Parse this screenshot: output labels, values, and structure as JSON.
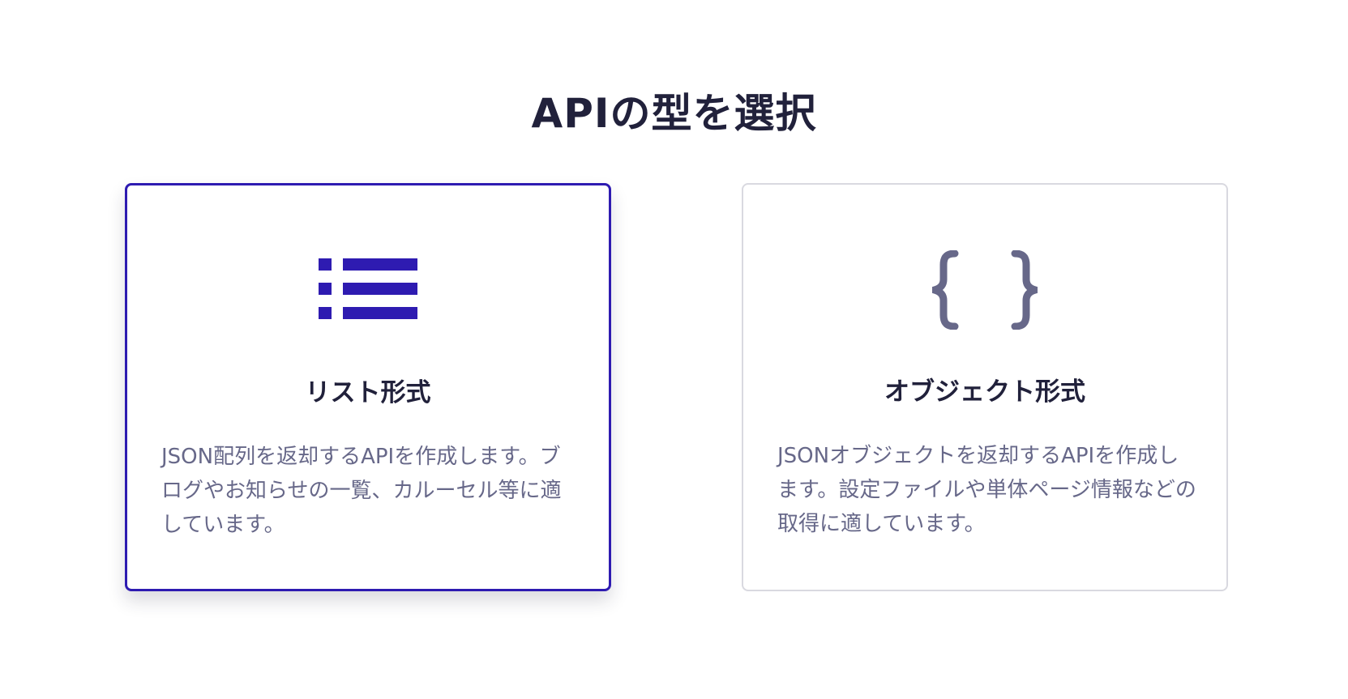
{
  "heading": "APIの型を選択",
  "colors": {
    "accent": "#2e1bb1",
    "text_dark": "#21213b",
    "text_muted": "#676889",
    "border_light": "#d9d9e0",
    "icon_muted": "#676889"
  },
  "options": [
    {
      "icon": "list-icon",
      "title": "リスト形式",
      "description": "JSON配列を返却するAPIを作成します。ブログやお知らせの一覧、カルーセル等に適しています。",
      "selected": true
    },
    {
      "icon": "braces-icon",
      "title": "オブジェクト形式",
      "description": "JSONオブジェクトを返却するAPIを作成します。設定ファイルや単体ページ情報などの取得に適しています。",
      "selected": false
    }
  ]
}
